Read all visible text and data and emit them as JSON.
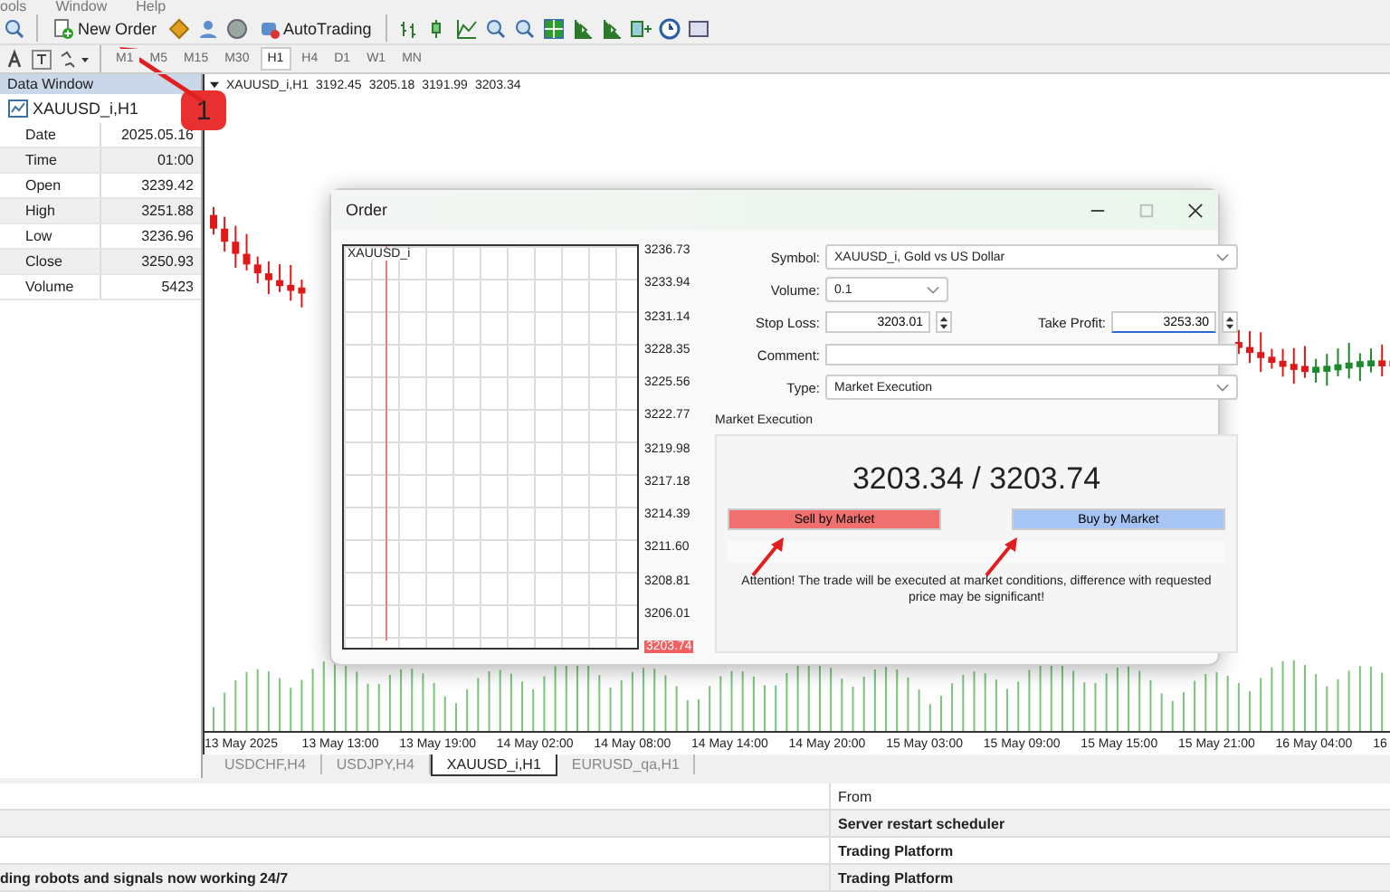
{
  "menu": [
    {
      "label": "ools"
    },
    {
      "label": "Window"
    },
    {
      "label": "Help"
    }
  ],
  "toolbar": {
    "new_order": "New Order",
    "auto_trading": "AutoTrading"
  },
  "timeframes": [
    {
      "label": "M1",
      "selected": false
    },
    {
      "label": "M5",
      "selected": false
    },
    {
      "label": "M15",
      "selected": false
    },
    {
      "label": "M30",
      "selected": false
    },
    {
      "label": "H1",
      "selected": true
    },
    {
      "label": "H4",
      "selected": false
    },
    {
      "label": "D1",
      "selected": false
    },
    {
      "label": "W1",
      "selected": false
    },
    {
      "label": "MN",
      "selected": false
    }
  ],
  "data_window": {
    "title": "Data Window",
    "symbol": "XAUUSD_i,H1",
    "rows": [
      {
        "label": "Date",
        "value": "2025.05.16"
      },
      {
        "label": "Time",
        "value": "01:00"
      },
      {
        "label": "Open",
        "value": "3239.42"
      },
      {
        "label": "High",
        "value": "3251.88"
      },
      {
        "label": "Low",
        "value": "3236.96"
      },
      {
        "label": "Close",
        "value": "3250.93"
      },
      {
        "label": "Volume",
        "value": "5423"
      }
    ]
  },
  "chart": {
    "symbol": "XAUUSD_i,H1",
    "ohlc": [
      "3192.45",
      "3205.18",
      "3191.99",
      "3203.34"
    ],
    "time_labels": [
      "13 May 2025",
      "13 May 13:00",
      "13 May 19:00",
      "14 May 02:00",
      "14 May 08:00",
      "14 May 14:00",
      "14 May 20:00",
      "15 May 03:00",
      "15 May 09:00",
      "15 May 15:00",
      "15 May 21:00",
      "16 May 04:00",
      "16"
    ]
  },
  "chart_tabs": [
    {
      "label": "USDCHF,H4",
      "selected": false
    },
    {
      "label": "USDJPY,H4",
      "selected": false
    },
    {
      "label": "XAUUSD_i,H1",
      "selected": true
    },
    {
      "label": "EURUSD_qa,H1",
      "selected": false
    }
  ],
  "journal": {
    "columns": [
      "From"
    ],
    "rows": [
      {
        "from": "Server restart scheduler"
      },
      {
        "from": "Trading Platform"
      },
      {
        "message": "ding robots and signals now working 24/7",
        "from": "Trading Platform"
      }
    ]
  },
  "order": {
    "title": "Order",
    "mini_chart": {
      "symbol": "XAUUSD_i",
      "price_scale": [
        "3236.73",
        "3233.94",
        "3231.14",
        "3228.35",
        "3225.56",
        "3222.77",
        "3219.98",
        "3217.18",
        "3214.39",
        "3211.60",
        "3208.81",
        "3206.01"
      ],
      "current_price": "3203.74"
    },
    "symbol": {
      "label": "Symbol:",
      "value": "XAUUSD_i, Gold vs US Dollar"
    },
    "volume": {
      "label": "Volume:",
      "value": "0.1"
    },
    "stop_loss": {
      "label": "Stop Loss:",
      "value": "3203.01"
    },
    "take_profit": {
      "label": "Take Profit:",
      "value": "3253.30",
      "focused": true
    },
    "comment": {
      "label": "Comment:"
    },
    "type": {
      "label": "Type:",
      "value": "Market Execution"
    },
    "group_title": "Market Execution",
    "prices": "3203.34 / 3203.74",
    "sell": "Sell by Market",
    "buy": "Buy by Market",
    "warning": "Attention! The trade will be executed at market conditions, difference with requested price may be significant!"
  },
  "annotations": [
    {
      "label": "1"
    }
  ]
}
